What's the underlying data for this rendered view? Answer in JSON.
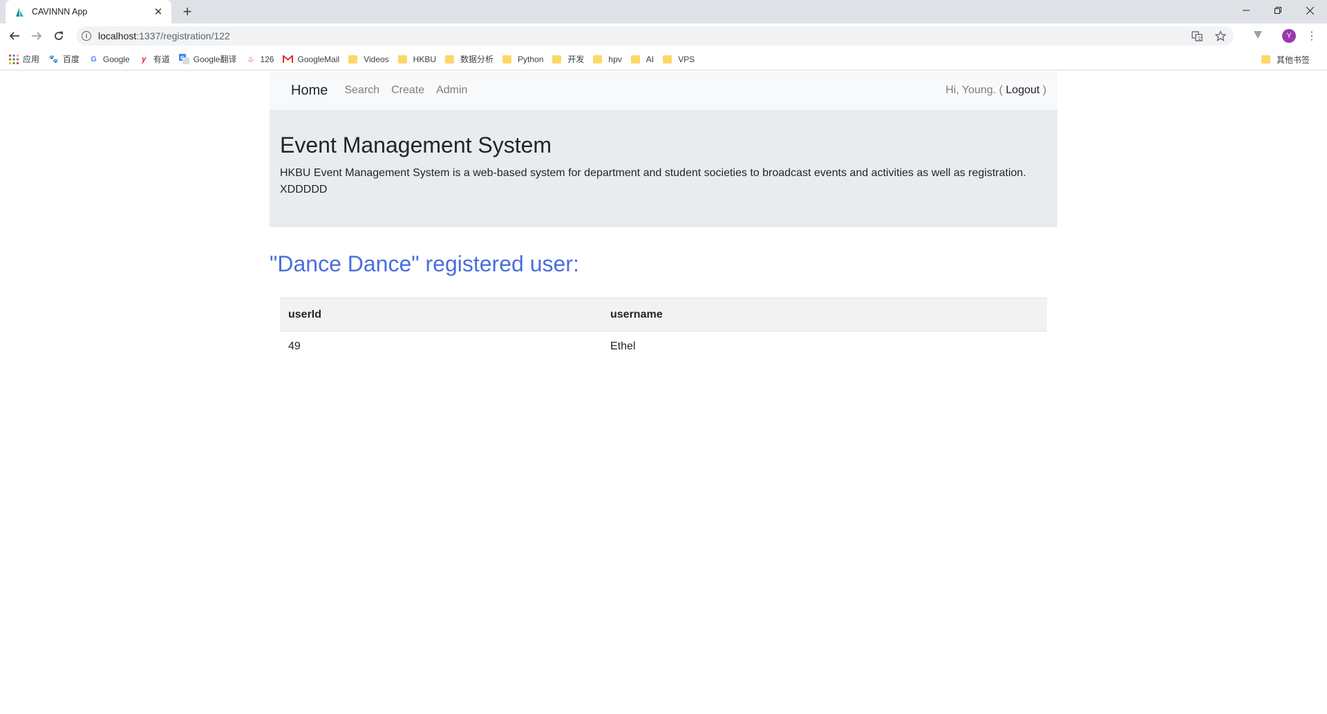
{
  "browser": {
    "tab_title": "CAVINNN App",
    "url_host": "localhost",
    "url_path": ":1337/registration/122",
    "profile_initial": "Y"
  },
  "bookmarks": [
    {
      "label": "应用",
      "icon": "apps-grid-icon",
      "kind": "icon"
    },
    {
      "label": "百度",
      "icon": "baidu-paw-icon",
      "kind": "icon"
    },
    {
      "label": "Google",
      "icon": "google-g-icon",
      "kind": "icon"
    },
    {
      "label": "有道",
      "icon": "youdao-y-icon",
      "kind": "icon"
    },
    {
      "label": "Google翻译",
      "icon": "google-translate-icon",
      "kind": "icon"
    },
    {
      "label": "126",
      "icon": "netease-126-icon",
      "kind": "icon"
    },
    {
      "label": "GoogleMail",
      "icon": "gmail-icon",
      "kind": "icon"
    },
    {
      "label": "Videos",
      "icon": "folder-icon",
      "kind": "folder"
    },
    {
      "label": "HKBU",
      "icon": "folder-icon",
      "kind": "folder"
    },
    {
      "label": "数据分析",
      "icon": "folder-icon",
      "kind": "folder"
    },
    {
      "label": "Python",
      "icon": "folder-icon",
      "kind": "folder"
    },
    {
      "label": "开发",
      "icon": "folder-icon",
      "kind": "folder"
    },
    {
      "label": "hpv",
      "icon": "folder-icon",
      "kind": "folder"
    },
    {
      "label": "AI",
      "icon": "folder-icon",
      "kind": "folder"
    },
    {
      "label": "VPS",
      "icon": "folder-icon",
      "kind": "folder"
    }
  ],
  "other_bookmarks": "其他书签",
  "navbar": {
    "brand": "Home",
    "links": [
      "Search",
      "Create",
      "Admin"
    ],
    "greeting": "Hi, Young. (",
    "logout": "Logout",
    "greeting_end": ")"
  },
  "jumbotron": {
    "title": "Event Management System",
    "lead": "HKBU Event Management System is a web-based system for department and student societies to broadcast events and activities as well as registration. XDDDDD"
  },
  "registration": {
    "heading": "\"Dance Dance\" registered user:",
    "columns": [
      "userId",
      "username"
    ],
    "rows": [
      {
        "userId": "49",
        "username": "Ethel"
      }
    ]
  },
  "colors": {
    "heading_blue": "#4a6ee0",
    "jumbotron_bg": "#e9ecef",
    "navbar_bg": "#f8f9fa"
  }
}
